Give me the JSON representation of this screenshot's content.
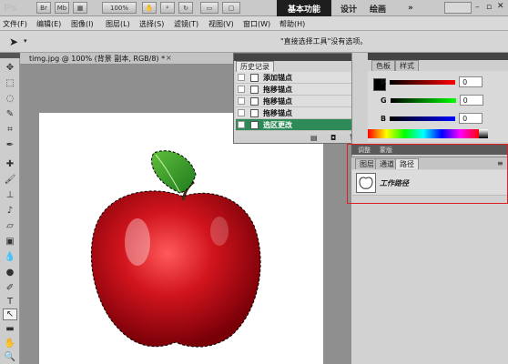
{
  "app": {
    "logo": "Ps"
  },
  "titlebar": {
    "br_btn": "Br",
    "mb_btn": "Mb",
    "zoom": "100%",
    "workspaces": [
      "基本功能",
      "设计",
      "绘画"
    ],
    "more": "»"
  },
  "menu": [
    "文件(F)",
    "编辑(E)",
    "图像(I)",
    "图层(L)",
    "选择(S)",
    "滤镜(T)",
    "视图(V)",
    "窗口(W)",
    "帮助(H)"
  ],
  "options": {
    "message": "\"直接选择工具\"没有选项。"
  },
  "document": {
    "title": "timg.jpg @ 100% (背景 副本, RGB/8) *",
    "close": "×"
  },
  "history": {
    "tab": "历史记录",
    "items": [
      {
        "label": "添加锚点",
        "selected": false
      },
      {
        "label": "拖移锚点",
        "selected": false
      },
      {
        "label": "拖移锚点",
        "selected": false
      },
      {
        "label": "拖移锚点",
        "selected": false
      },
      {
        "label": "选区更改",
        "selected": true
      }
    ]
  },
  "color_panel": {
    "tabs": [
      "色板",
      "样式"
    ],
    "channels": [
      {
        "name": "R",
        "value": "0",
        "color": "#cc0000"
      },
      {
        "name": "G",
        "value": "0",
        "color": "#22aa22"
      },
      {
        "name": "B",
        "value": "0",
        "color": "#1a3ad0"
      }
    ]
  },
  "adjust_tabs": [
    "调整",
    "蒙版"
  ],
  "layers_tabs": [
    "图层",
    "通道",
    "路径"
  ],
  "paths": {
    "item": "工作路径"
  }
}
